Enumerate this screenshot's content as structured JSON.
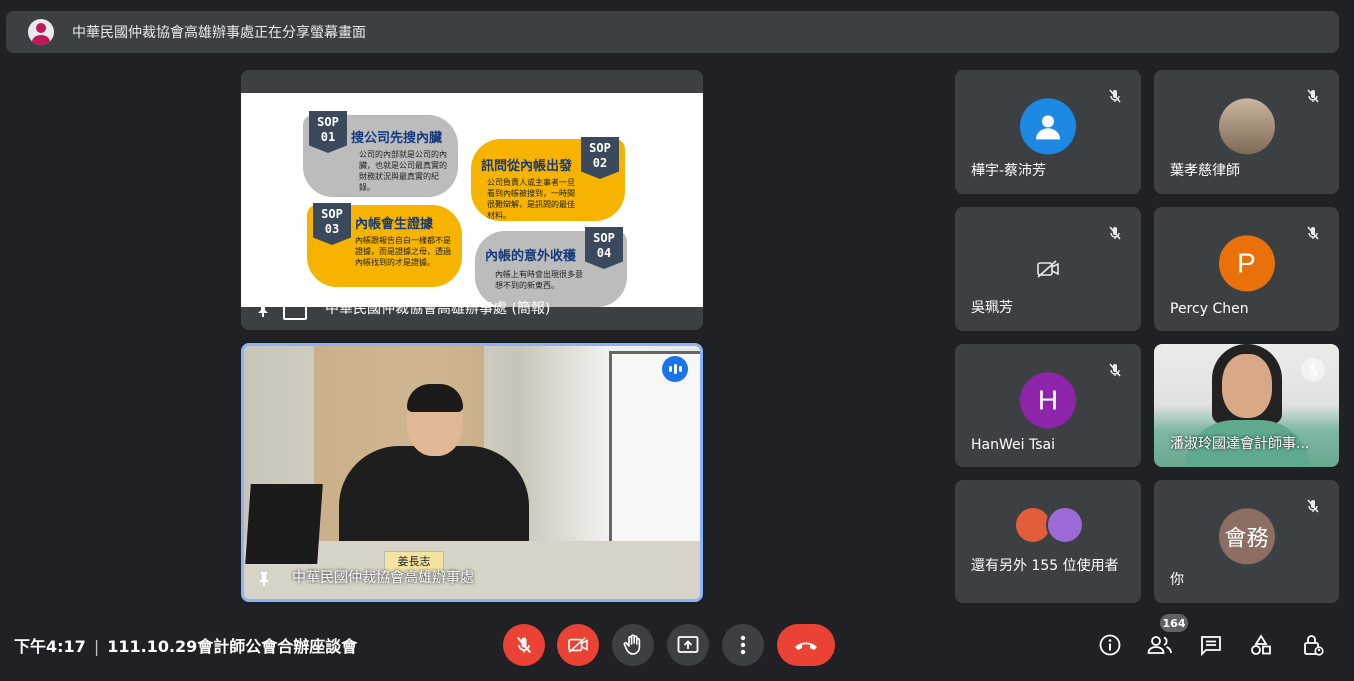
{
  "banner": {
    "text": "中華民國仲裁協會高雄辦事處正在分享螢幕畫面"
  },
  "presentation": {
    "caption": "中華民國仲裁協會高雄辦事處 (簡報)",
    "slide": {
      "items": [
        {
          "badge_top": "SOP",
          "badge_num": "01",
          "title": "搜公司先搜內臟",
          "body": "公司的內部就是公司的內臟，也就是公司最真實的財務狀況與最真實的紀錄。"
        },
        {
          "badge_top": "SOP",
          "badge_num": "02",
          "title": "訊問從內帳出發",
          "body": "公司負責人或主事者一旦看到內帳被搜到，一時間很難辯解，是訊問的最佳材料。"
        },
        {
          "badge_top": "SOP",
          "badge_num": "03",
          "title": "內帳會生證據",
          "body": "內帳跟報告自白一樣都不是證據，而是證據之母，透過內帳找到的才是證據。"
        },
        {
          "badge_top": "SOP",
          "badge_num": "04",
          "title": "內帳的意外收穫",
          "body": "內帳上有時會出現很多意想不到的新東西。"
        }
      ]
    }
  },
  "video": {
    "caption": "中華民國仲裁協會高雄辦事處",
    "nameplate": "姜長志"
  },
  "participants": [
    {
      "name": "樺宇-蔡沛芳",
      "type": "avatar-blue"
    },
    {
      "name": "葉孝慈律師",
      "type": "photo"
    },
    {
      "name": "吳珮芳",
      "type": "camera-off"
    },
    {
      "name": "Percy Chen",
      "type": "letter",
      "letter": "P",
      "color": "#e8710a"
    },
    {
      "name": "HanWei Tsai",
      "type": "letter",
      "letter": "H",
      "color": "#8e24aa"
    },
    {
      "name": "潘淑玲國達會計師事...",
      "type": "video"
    },
    {
      "name": "還有另外 155 位使用者",
      "type": "others"
    },
    {
      "name": "你",
      "type": "letter",
      "letter": "會務",
      "color": "#8d6e63"
    }
  ],
  "bottom": {
    "time": "下午4:17",
    "meeting": "111.10.29會計師公會合辦座談會",
    "participant_count": "164"
  },
  "colors": {
    "bg": "#202124",
    "tile": "#3c4043",
    "danger": "#ea4335",
    "accent": "#8ab4f8"
  }
}
